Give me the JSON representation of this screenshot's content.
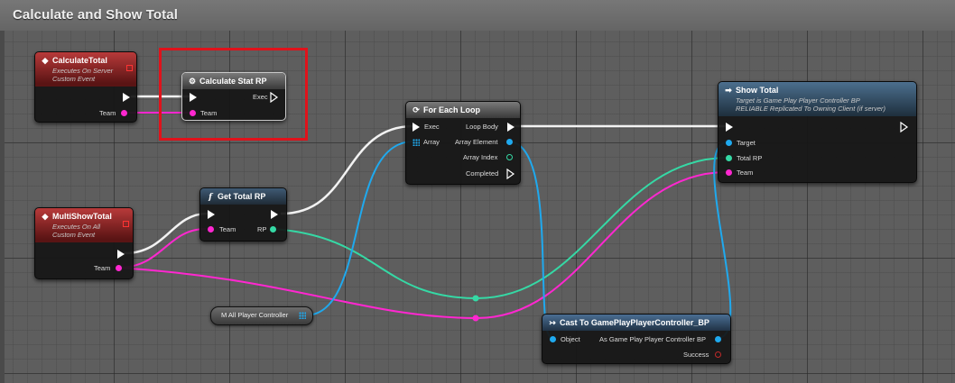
{
  "window": {
    "title": "Calculate and Show Total"
  },
  "nodes": {
    "calculate_total": {
      "title": "CalculateTotal",
      "subtitle1": "Executes On Server",
      "subtitle2": "Custom Event",
      "pin_team": "Team"
    },
    "calculate_stat_rp": {
      "title": "Calculate Stat RP",
      "pin_exec": "Exec",
      "pin_team": "Team"
    },
    "for_each_loop": {
      "title": "For Each Loop",
      "pin_exec": "Exec",
      "pin_array": "Array",
      "pin_loop_body": "Loop Body",
      "pin_array_element": "Array Element",
      "pin_array_index": "Array Index",
      "pin_completed": "Completed"
    },
    "show_total": {
      "title": "Show Total",
      "subtitle1": "Target is Game Play Player Controller BP",
      "subtitle2": "RELIABLE Replicated To Owning Client (if server)",
      "pin_target": "Target",
      "pin_total_rp": "Total RP",
      "pin_team": "Team"
    },
    "multi_show_total": {
      "title": "MultiShowTotal",
      "subtitle1": "Executes On All",
      "subtitle2": "Custom Event",
      "pin_team": "Team"
    },
    "get_total_rp": {
      "title": "Get Total RP",
      "pin_team": "Team",
      "pin_rp": "RP"
    },
    "m_all_player_controller": {
      "label": "M All Player Controller"
    },
    "cast_to": {
      "title": "Cast To GamePlayPlayerController_BP",
      "pin_object": "Object",
      "pin_as": "As Game Play Player Controller BP",
      "pin_success": "Success"
    }
  },
  "colors": {
    "exec": "#ffffff",
    "object": "#1fa9ee",
    "enum_team": "#ff27d0",
    "int": "#35d9a5",
    "bool": "#c12a2a",
    "highlight": "#e0121b"
  },
  "icons": {
    "event": "diamond-icon",
    "function": "f-icon",
    "macro": "loop-icon",
    "cast": "cast-arrows-icon",
    "array": "array-grid-icon"
  }
}
